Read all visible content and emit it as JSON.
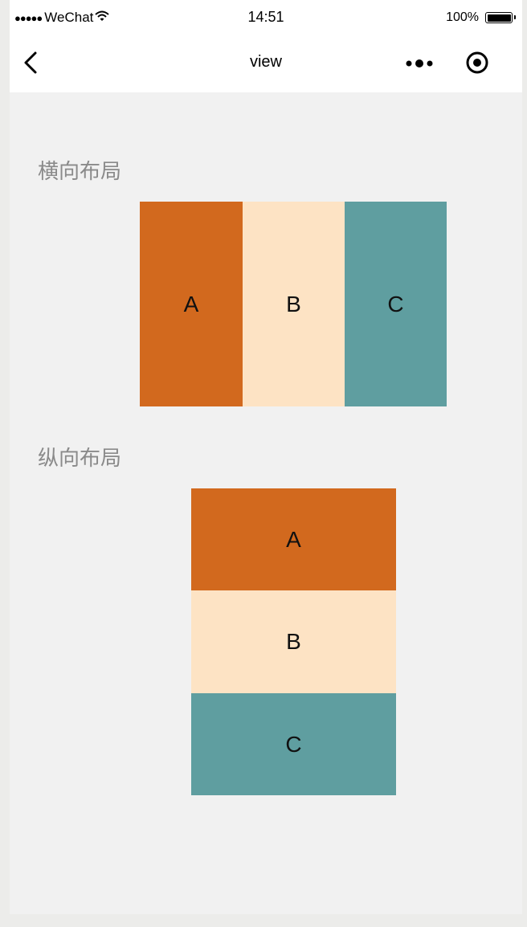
{
  "status_bar": {
    "signal": "●●●●●",
    "carrier": "WeChat",
    "time": "14:51",
    "battery": "100%"
  },
  "nav": {
    "title": "view"
  },
  "horizontal": {
    "title": "横向布局",
    "items": [
      "A",
      "B",
      "C"
    ]
  },
  "vertical": {
    "title": "纵向布局",
    "items": [
      "A",
      "B",
      "C"
    ]
  },
  "colors": {
    "a": "#d2691e",
    "b": "#fde3c4",
    "c": "#5f9ea0"
  },
  "icons": [
    "wifi-icon",
    "battery-icon",
    "back-arrow-icon",
    "more-dots-icon",
    "capsule-target-icon"
  ]
}
